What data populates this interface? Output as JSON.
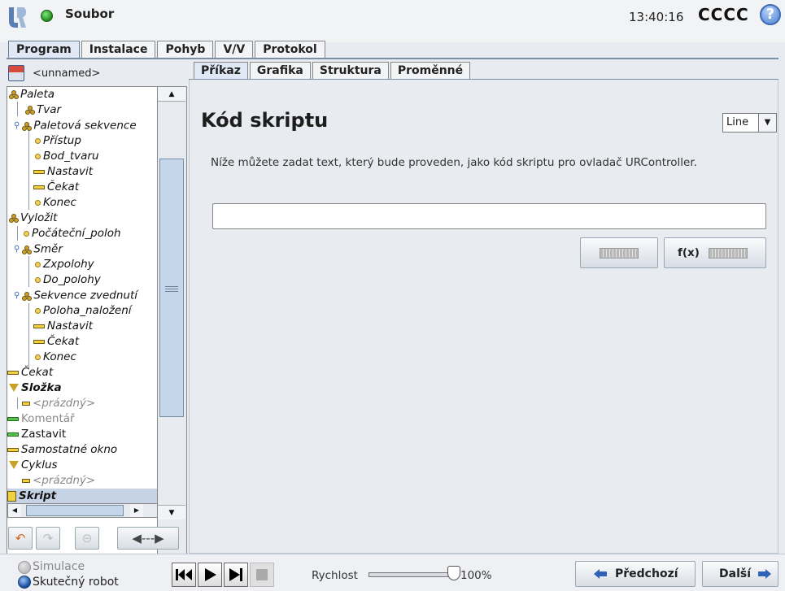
{
  "topbar": {
    "file_menu": "Soubor",
    "clock": "13:40:16",
    "robot_name": "CCCC",
    "help": "?"
  },
  "main_tabs": [
    {
      "label": "Program",
      "active": true
    },
    {
      "label": "Instalace",
      "active": false
    },
    {
      "label": "Pohyb",
      "active": false
    },
    {
      "label": "V/V",
      "active": false
    },
    {
      "label": "Protokol",
      "active": false
    }
  ],
  "program": {
    "name": "<unnamed>",
    "tree": [
      {
        "label": "Paleta",
        "icon": "dots-icon"
      },
      {
        "label": "Tvar",
        "icon": "dots-icon"
      },
      {
        "label": "Paletová sekvence",
        "icon": "dots-icon"
      },
      {
        "label": "Přístup",
        "icon": "waypoint-icon"
      },
      {
        "label": "Bod_tvaru",
        "icon": "waypoint-icon"
      },
      {
        "label": "Nastavit",
        "icon": "set-icon"
      },
      {
        "label": "Čekat",
        "icon": "wait-icon"
      },
      {
        "label": "Konec",
        "icon": "waypoint-icon"
      },
      {
        "label": "Vyložit",
        "icon": "dots-icon"
      },
      {
        "label": "Počáteční_poloh",
        "icon": "waypoint-icon"
      },
      {
        "label": "Směr",
        "icon": "dots-icon"
      },
      {
        "label": "Zxpolohy",
        "icon": "waypoint-icon"
      },
      {
        "label": "Do_polohy",
        "icon": "waypoint-icon"
      },
      {
        "label": "Sekvence zvednutí",
        "icon": "dots-icon"
      },
      {
        "label": "Poloha_naložení",
        "icon": "waypoint-icon"
      },
      {
        "label": "Nastavit",
        "icon": "set-icon"
      },
      {
        "label": "Čekat",
        "icon": "wait-icon"
      },
      {
        "label": "Konec",
        "icon": "waypoint-icon"
      },
      {
        "label": "Čekat",
        "icon": "wait-icon"
      },
      {
        "label": "Složka",
        "icon": "folder-icon"
      },
      {
        "label": "<prázdný>",
        "icon": "empty-icon"
      },
      {
        "label": "Komentář",
        "icon": "comment-icon"
      },
      {
        "label": "Zastavit",
        "icon": "halt-icon"
      },
      {
        "label": "Samostatné okno",
        "icon": "popup-icon"
      },
      {
        "label": "Cyklus",
        "icon": "loop-icon"
      },
      {
        "label": "<prázdný>",
        "icon": "empty-icon"
      },
      {
        "label": "Skript",
        "icon": "script-icon"
      }
    ]
  },
  "sub_tabs": [
    {
      "label": "Příkaz",
      "active": true
    },
    {
      "label": "Grafika",
      "active": false
    },
    {
      "label": "Struktura",
      "active": false
    },
    {
      "label": "Proměnné",
      "active": false
    }
  ],
  "command": {
    "title": "Kód skriptu",
    "line_select": "Line",
    "description": "Níže můžete zadat text, který bude proveden, jako kód skriptu pro ovladač URController.",
    "script_value": "",
    "fx_label": "f(x)"
  },
  "bottom": {
    "simulation_label": "Simulace",
    "real_robot_label": "Skutečný robot",
    "speed_label": "Rychlost",
    "speed_value": "100%",
    "speed_fraction": 1.0,
    "prev_label": "Předchozí",
    "next_label": "Další"
  },
  "colors": {
    "accent": "#3d6ab5",
    "status_ok": "#1f8a1c"
  }
}
